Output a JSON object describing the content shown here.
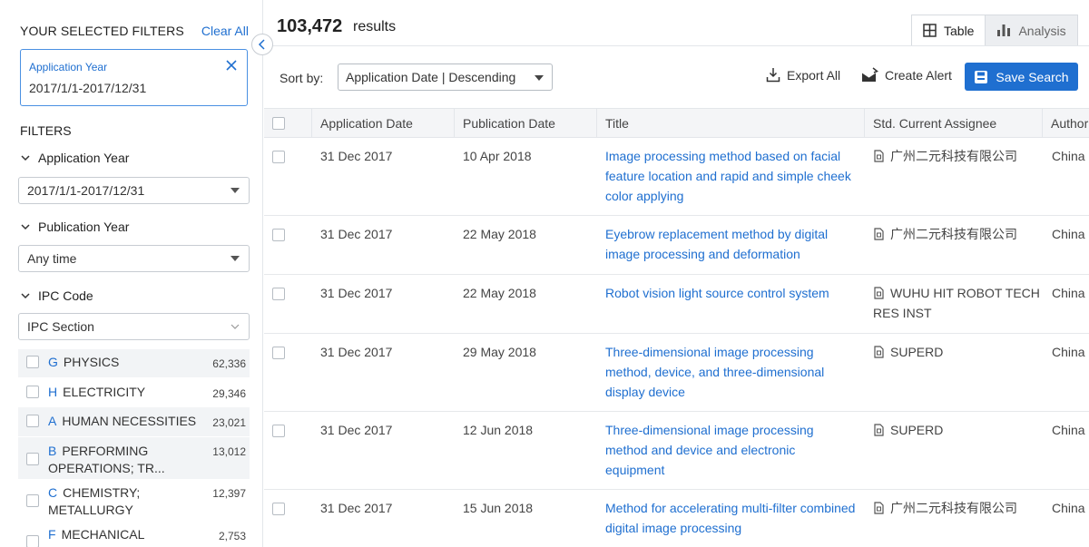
{
  "sidebar": {
    "selected_title": "YOUR SELECTED FILTERS",
    "clear_all": "Clear All",
    "chip": {
      "label": "Application Year",
      "value": "2017/1/1-2017/12/31"
    },
    "filters_title": "FILTERS",
    "sections": [
      {
        "label": "Application Year",
        "select_value": "2017/1/1-2017/12/31"
      },
      {
        "label": "Publication Year",
        "select_value": "Any time"
      },
      {
        "label": "IPC Code",
        "select_value": "IPC Section"
      }
    ],
    "ipc_items": [
      {
        "code": "G",
        "name": "PHYSICS",
        "count": "62,336"
      },
      {
        "code": "H",
        "name": "ELECTRICITY",
        "count": "29,346"
      },
      {
        "code": "A",
        "name": "HUMAN NECESSITIES",
        "count": "23,021"
      },
      {
        "code": "B",
        "name": "PERFORMING OPERATIONS; TR...",
        "count": "13,012"
      },
      {
        "code": "C",
        "name": "CHEMISTRY; METALLURGY",
        "count": "12,397"
      },
      {
        "code": "F",
        "name": "MECHANICAL",
        "count": "2,753"
      }
    ]
  },
  "header": {
    "count": "103,472",
    "count_label": "results",
    "tabs": [
      {
        "label": "Table",
        "icon": "table-grid-icon",
        "active": true
      },
      {
        "label": "Analysis",
        "icon": "bar-chart-icon",
        "active": false
      }
    ]
  },
  "toolbar": {
    "sort_label": "Sort by:",
    "sort_value": "Application Date | Descending",
    "export_label": "Export All",
    "alert_label": "Create Alert",
    "save_label": "Save Search",
    "accent_color": "#1f6fd0"
  },
  "table": {
    "columns": [
      "Application Date",
      "Publication Date",
      "Title",
      "Std. Current Assignee",
      "Author"
    ],
    "rows": [
      {
        "app_date": "31 Dec 2017",
        "pub_date": "10 Apr 2018",
        "title": "Image processing method based on facial feature location and rapid and simple cheek color applying",
        "assignee": "广州二元科技有限公司",
        "author": "China"
      },
      {
        "app_date": "31 Dec 2017",
        "pub_date": "22 May 2018",
        "title": "Eyebrow replacement method by digital image processing and deformation",
        "assignee": "广州二元科技有限公司",
        "author": "China"
      },
      {
        "app_date": "31 Dec 2017",
        "pub_date": "22 May 2018",
        "title": "Robot vision light source control system",
        "assignee": "WUHU HIT ROBOT TECH RES INST",
        "author": "China"
      },
      {
        "app_date": "31 Dec 2017",
        "pub_date": "29 May 2018",
        "title": "Three-dimensional image processing method, device, and three-dimensional display device",
        "assignee": "SUPERD",
        "author": "China"
      },
      {
        "app_date": "31 Dec 2017",
        "pub_date": "12 Jun 2018",
        "title": "Three-dimensional image processing method and device and electronic equipment",
        "assignee": "SUPERD",
        "author": "China"
      },
      {
        "app_date": "31 Dec 2017",
        "pub_date": "15 Jun 2018",
        "title": "Method for accelerating multi-filter combined digital image processing",
        "assignee": "广州二元科技有限公司",
        "author": "China"
      }
    ]
  }
}
